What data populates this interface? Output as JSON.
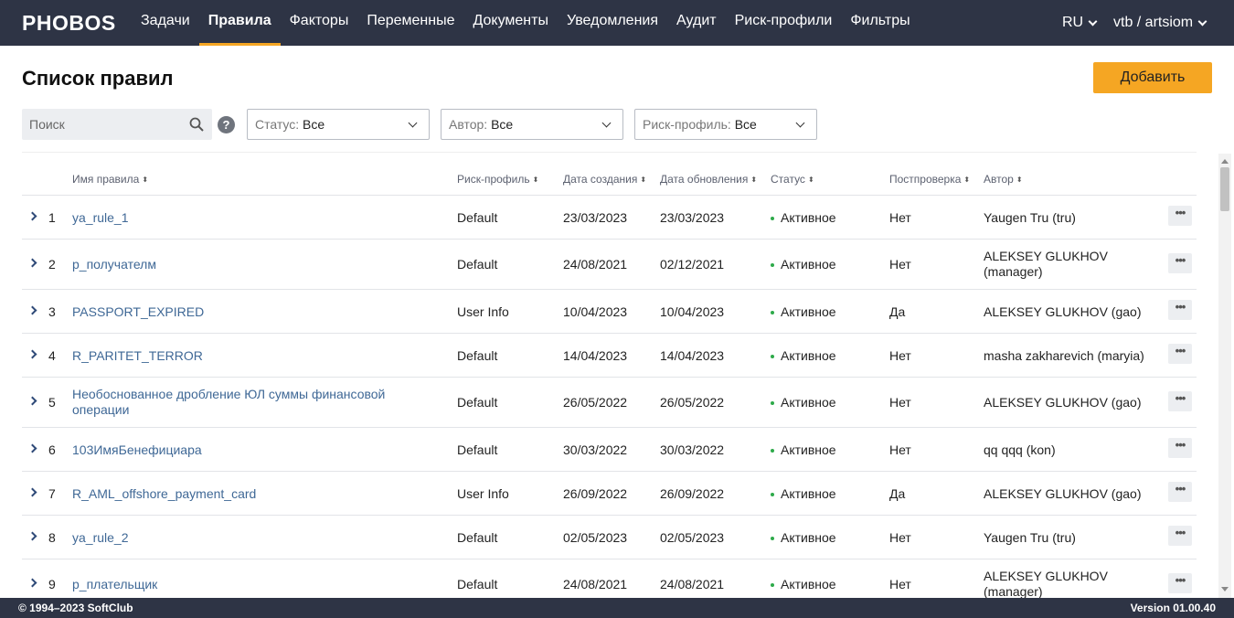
{
  "app": {
    "logo": "PHOBOS"
  },
  "nav": {
    "items": [
      {
        "label": "Задачи"
      },
      {
        "label": "Правила"
      },
      {
        "label": "Факторы"
      },
      {
        "label": "Переменные"
      },
      {
        "label": "Документы"
      },
      {
        "label": "Уведомления"
      },
      {
        "label": "Аудит"
      },
      {
        "label": "Риск-профили"
      },
      {
        "label": "Фильтры"
      }
    ],
    "active_index": 1,
    "language": "RU",
    "user": "vtb / artsiom"
  },
  "header": {
    "title": "Список правил",
    "add_label": "Добавить"
  },
  "filters": {
    "search_placeholder": "Поиск",
    "help": "?",
    "status": {
      "label": "Статус:",
      "value": "Все"
    },
    "author": {
      "label": "Автор:",
      "value": "Все"
    },
    "risk_profile": {
      "label": "Риск-профиль:",
      "value": "Все"
    }
  },
  "table": {
    "columns": {
      "name": "Имя правила",
      "risk": "Риск-профиль",
      "created": "Дата создания",
      "updated": "Дата обновления",
      "status": "Статус",
      "postcheck": "Постпроверка",
      "author": "Автор"
    },
    "more_label": "•••",
    "rows": [
      {
        "num": "1",
        "name": "ya_rule_1",
        "risk": "Default",
        "created": "23/03/2023",
        "updated": "23/03/2023",
        "status": "Активное",
        "postcheck": "Нет",
        "author": "Yaugen Tru (tru)"
      },
      {
        "num": "2",
        "name": "p_получателм",
        "risk": "Default",
        "created": "24/08/2021",
        "updated": "02/12/2021",
        "status": "Активное",
        "postcheck": "Нет",
        "author": "ALEKSEY GLUKHOV (manager)"
      },
      {
        "num": "3",
        "name": "PASSPORT_EXPIRED",
        "risk": "User Info",
        "created": "10/04/2023",
        "updated": "10/04/2023",
        "status": "Активное",
        "postcheck": "Да",
        "author": "ALEKSEY GLUKHOV (gao)"
      },
      {
        "num": "4",
        "name": "R_PARITET_TERROR",
        "risk": "Default",
        "created": "14/04/2023",
        "updated": "14/04/2023",
        "status": "Активное",
        "postcheck": "Нет",
        "author": "masha zakharevich (maryia)"
      },
      {
        "num": "5",
        "name": "Необоснованное дробление ЮЛ суммы финансовой операции",
        "risk": "Default",
        "created": "26/05/2022",
        "updated": "26/05/2022",
        "status": "Активное",
        "postcheck": "Нет",
        "author": "ALEKSEY GLUKHOV (gao)"
      },
      {
        "num": "6",
        "name": "103ИмяБенефициара",
        "risk": "Default",
        "created": "30/03/2022",
        "updated": "30/03/2022",
        "status": "Активное",
        "postcheck": "Нет",
        "author": "qq qqq (kon)"
      },
      {
        "num": "7",
        "name": "R_AML_offshore_payment_card",
        "risk": "User Info",
        "created": "26/09/2022",
        "updated": "26/09/2022",
        "status": "Активное",
        "postcheck": "Да",
        "author": "ALEKSEY GLUKHOV (gao)"
      },
      {
        "num": "8",
        "name": "ya_rule_2",
        "risk": "Default",
        "created": "02/05/2023",
        "updated": "02/05/2023",
        "status": "Активное",
        "postcheck": "Нет",
        "author": "Yaugen Tru (tru)"
      },
      {
        "num": "9",
        "name": "p_плательщик",
        "risk": "Default",
        "created": "24/08/2021",
        "updated": "24/08/2021",
        "status": "Активное",
        "postcheck": "Нет",
        "author": "ALEKSEY GLUKHOV (manager)"
      }
    ]
  },
  "footer": {
    "copyright": "© 1994–2023 SoftClub",
    "version": "Version 01.00.40"
  },
  "colors": {
    "topbar": "#2e3445",
    "accent": "#f5a623",
    "link": "#3f6896",
    "status_active": "#2eaa4a"
  }
}
